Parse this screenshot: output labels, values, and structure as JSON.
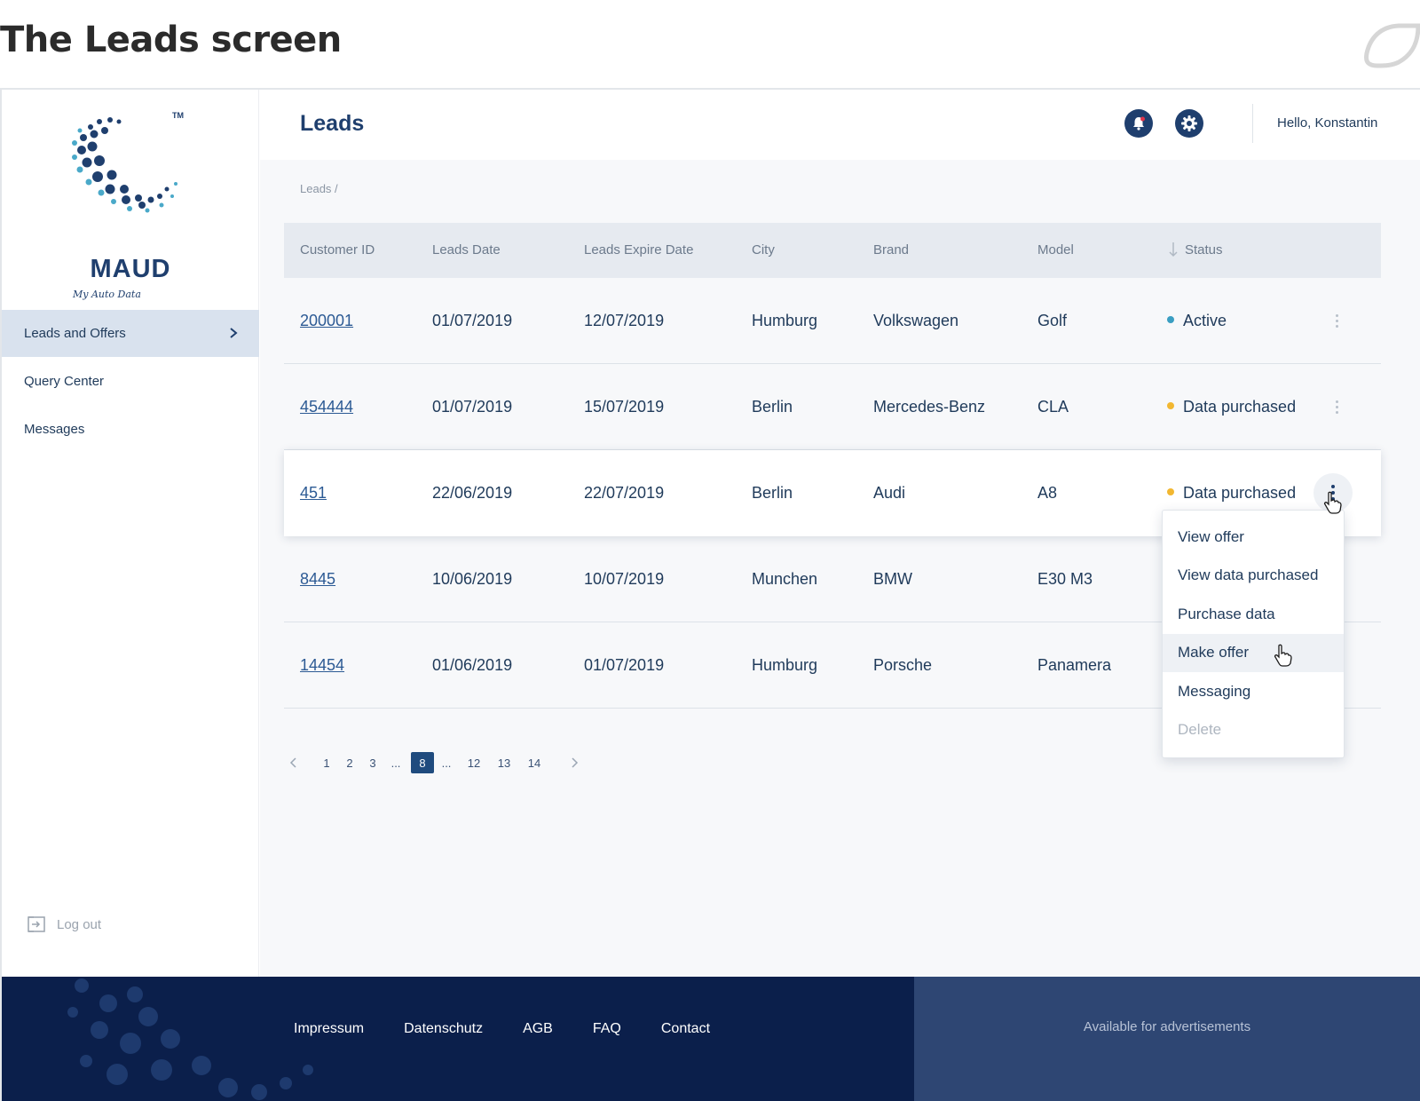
{
  "page_heading": "The Leads screen",
  "brand": {
    "name": "MAUD",
    "tagline": "My Auto Data",
    "tm": "TM"
  },
  "sidebar": {
    "items": [
      {
        "label": "Leads and Offers"
      },
      {
        "label": "Query Center"
      },
      {
        "label": "Messages"
      }
    ],
    "logout_label": "Log out"
  },
  "header": {
    "title": "Leads",
    "greeting": "Hello, Konstantin"
  },
  "breadcrumb": "Leads /",
  "table": {
    "headers": [
      "Customer ID",
      "Leads Date",
      "Leads Expire Date",
      "City",
      "Brand",
      "Model",
      "Status"
    ],
    "rows": [
      {
        "id": "200001",
        "leads_date": "01/07/2019",
        "expire_date": "12/07/2019",
        "city": "Humburg",
        "brand": "Volkswagen",
        "model": "Golf",
        "status": "Active"
      },
      {
        "id": "454444",
        "leads_date": "01/07/2019",
        "expire_date": "15/07/2019",
        "city": "Berlin",
        "brand": "Mercedes-Benz",
        "model": "CLA",
        "status": "Data purchased"
      },
      {
        "id": "451",
        "leads_date": "22/06/2019",
        "expire_date": "22/07/2019",
        "city": "Berlin",
        "brand": "Audi",
        "model": "A8",
        "status": "Data purchased"
      },
      {
        "id": "8445",
        "leads_date": "10/06/2019",
        "expire_date": "10/07/2019",
        "city": "Munchen",
        "brand": "BMW",
        "model": "E30 M3",
        "status": ""
      },
      {
        "id": "14454",
        "leads_date": "01/06/2019",
        "expire_date": "01/07/2019",
        "city": "Humburg",
        "brand": "Porsche",
        "model": "Panamera",
        "status": ""
      }
    ]
  },
  "status_colors": {
    "active": "#3a9ec2",
    "data_purchased": "#f2b731"
  },
  "pagination": {
    "pages": [
      "1",
      "2",
      "3",
      "...",
      "8",
      "...",
      "12",
      "13",
      "14"
    ],
    "current": "8"
  },
  "row_menu": {
    "items": [
      "View offer",
      "View data purchased",
      "Purchase data",
      "Make offer",
      "Messaging",
      "Delete"
    ]
  },
  "footer": {
    "links": [
      "Impressum",
      "Datenschutz",
      "AGB",
      "FAQ",
      "Contact"
    ],
    "ad_text": "Available for advertisements"
  },
  "colors": {
    "brand_navy": "#1f3f6e",
    "footer_bg": "#0b1f4b",
    "footer_ad_bg": "#2e4673"
  }
}
